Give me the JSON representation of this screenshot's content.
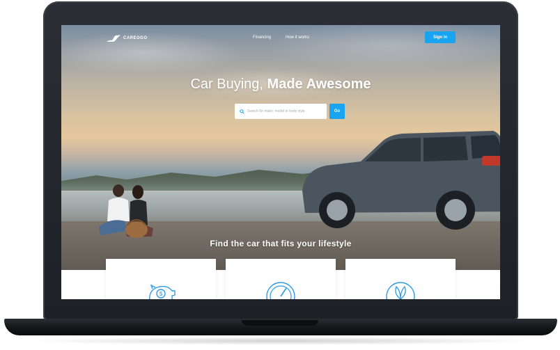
{
  "brand": {
    "name": "CAREOGO"
  },
  "nav": {
    "links": [
      "Financing",
      "How it works"
    ],
    "signin_label": "Sign In"
  },
  "hero": {
    "title_regular": "Car Buying, ",
    "title_bold": "Made Awesome",
    "search": {
      "placeholder": "Search for make, model or body style",
      "button_label": "Go"
    },
    "tagline": "Find the car that fits your lifestyle"
  },
  "features": {
    "cards": [
      {
        "icon": "piggy-bank-icon"
      },
      {
        "icon": "speedometer-icon"
      },
      {
        "icon": "leaf-icon"
      }
    ]
  },
  "colors": {
    "accent": "#18a4f1",
    "icon_stroke": "#2c9be8"
  }
}
